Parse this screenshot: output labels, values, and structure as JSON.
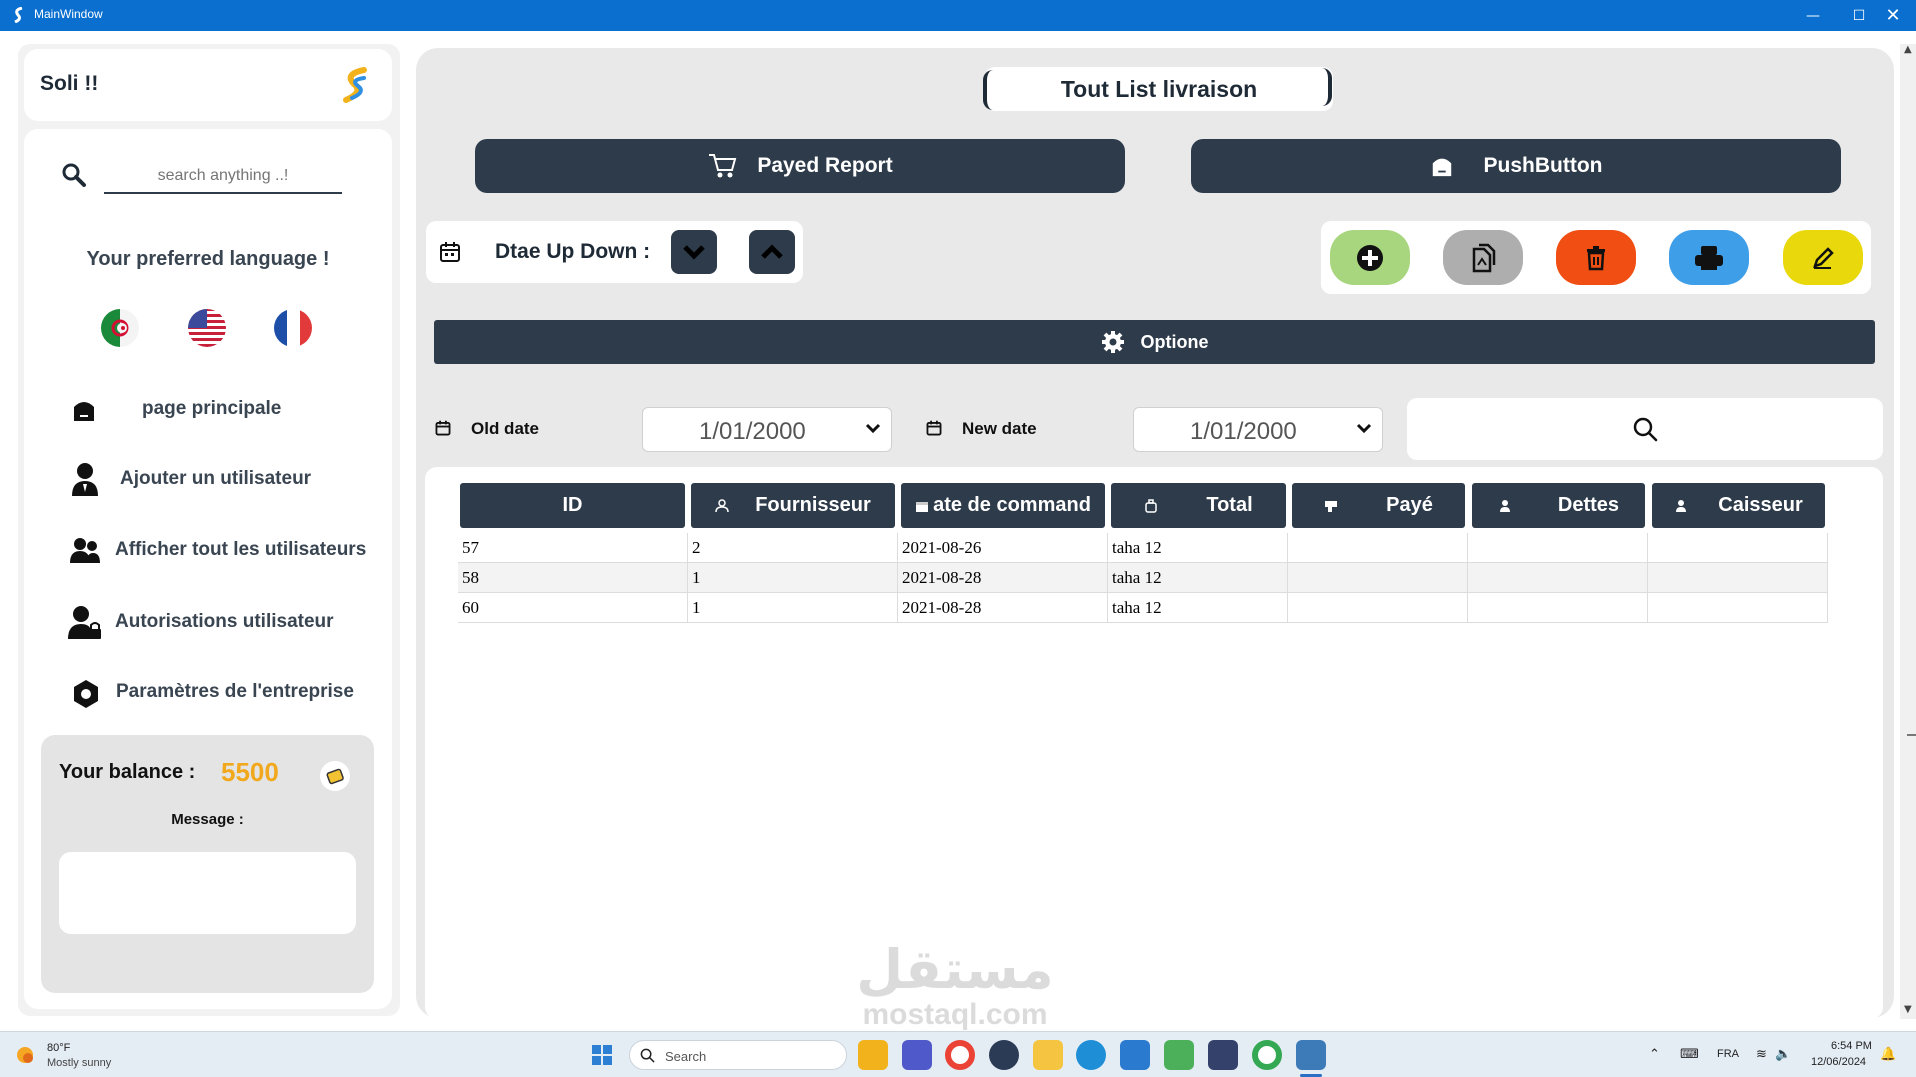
{
  "window": {
    "title": "MainWindow"
  },
  "sidebar": {
    "app_name": "Soli !!",
    "search_placeholder": "search anything ..!",
    "language_heading": "Your preferred language !",
    "languages": [
      "algeria-flag",
      "usa-flag",
      "france-flag"
    ],
    "nav": [
      {
        "label": "page principale",
        "icon": "home-icon"
      },
      {
        "label": "Ajouter un utilisateur",
        "icon": "user-add-icon"
      },
      {
        "label": "Afficher tout les utilisateurs",
        "icon": "users-icon"
      },
      {
        "label": "Autorisations utilisateur",
        "icon": "user-lock-icon"
      },
      {
        "label": "Paramètres de l'entreprise",
        "icon": "settings-hex-icon"
      }
    ],
    "balance_label": "Your balance :",
    "balance_value": "5500",
    "message_label": "Message :"
  },
  "main": {
    "page_title": "Tout List livraison",
    "payed_report_label": "Payed Report",
    "push_button_label": "PushButton",
    "date_sort_label": "Dtae Up Down :",
    "options_label": "Optione",
    "old_date_label": "Old date",
    "old_date_value": "1/01/2000",
    "new_date_label": "New date",
    "new_date_value": "1/01/2000",
    "action_colors": {
      "add": "#a8d67e",
      "copy": "#aeaeae",
      "delete": "#f04e12",
      "print": "#3f9ee8",
      "edit": "#e8d80c"
    },
    "table": {
      "headers": [
        "ID",
        "Fournisseur",
        " ate de command",
        "Total",
        "Payé",
        "Dettes",
        "Caisseur"
      ],
      "rows": [
        [
          "57",
          "2",
          "2021-08-26",
          "taha 12",
          "",
          "",
          ""
        ],
        [
          "58",
          "1",
          "2021-08-28",
          "taha 12",
          "",
          "",
          ""
        ],
        [
          "60",
          "1",
          "2021-08-28",
          "taha 12",
          "",
          "",
          ""
        ]
      ]
    }
  },
  "watermark": {
    "arabic": "مستقل",
    "latin": "mostaql.com"
  },
  "taskbar": {
    "weather_temp": "80°F",
    "weather_desc": "Mostly sunny",
    "search_label": "Search",
    "lang": "FRA",
    "time": "6:54 PM",
    "date": "12/06/2024"
  }
}
